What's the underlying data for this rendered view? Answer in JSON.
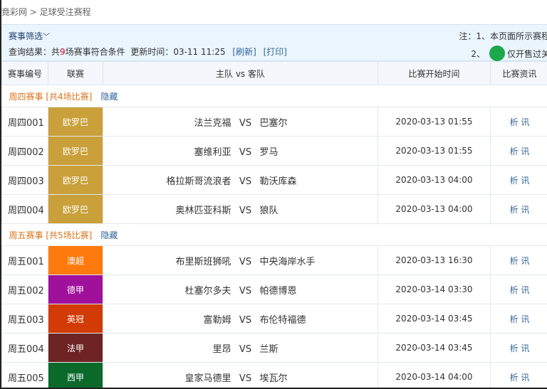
{
  "breadcrumb": "竟彩网 > 足球受注赛程",
  "filter": {
    "toggle_label": "赛事筛选",
    "result_prefix": "查询结果：共",
    "result_count": "9",
    "result_suffix": "场赛事符合条件",
    "update_label": "更新时间：03-11 11:25",
    "refresh_link": "[刷新]",
    "print_link": "[打印]",
    "note1": "注：1、本页面所示赛程",
    "note2_prefix": "2、",
    "note2_suffix": "仅开售过关"
  },
  "table": {
    "headers": [
      "赛事编号",
      "联赛",
      "主队 vs 客队",
      "比赛开始时间",
      "比赛资讯"
    ]
  },
  "groups": [
    {
      "title": "周四赛事 [共4场比赛]",
      "hide_label": "隐藏",
      "matches": [
        {
          "num": "周四001",
          "league": "欧罗巴",
          "color": "#c9a03a",
          "home": "法兰克福",
          "vs": "VS",
          "away": "巴塞尔",
          "time": "2020-03-13 01:55",
          "info": "析 讯"
        },
        {
          "num": "周四002",
          "league": "欧罗巴",
          "color": "#c9a03a",
          "home": "塞维利亚",
          "vs": "VS",
          "away": "罗马",
          "time": "2020-03-13 01:55",
          "info": "析 讯"
        },
        {
          "num": "周四003",
          "league": "欧罗巴",
          "color": "#c9a03a",
          "home": "格拉斯哥流浪者",
          "vs": "VS",
          "away": "勒沃库森",
          "time": "2020-03-13 04:00",
          "info": "析 讯"
        },
        {
          "num": "周四004",
          "league": "欧罗巴",
          "color": "#c9a03a",
          "home": "奥林匹亚科斯",
          "vs": "VS",
          "away": "狼队",
          "time": "2020-03-13 04:00",
          "info": "析 讯"
        }
      ]
    },
    {
      "title": "周五赛事 [共5场比赛]",
      "hide_label": "隐藏",
      "matches": [
        {
          "num": "周五001",
          "league": "澳超",
          "color": "#ff7a0d",
          "home": "布里斯班狮吼",
          "vs": "VS",
          "away": "中央海岸水手",
          "time": "2020-03-13 16:30",
          "info": "析 讯"
        },
        {
          "num": "周五002",
          "league": "德甲",
          "color": "#a0109b",
          "home": "杜塞尔多夫",
          "vs": "VS",
          "away": "帕德博恩",
          "time": "2020-03-14 03:30",
          "info": "析 讯"
        },
        {
          "num": "周五003",
          "league": "英冠",
          "color": "#d23a06",
          "home": "富勒姆",
          "vs": "VS",
          "away": "布伦特福德",
          "time": "2020-03-14 03:45",
          "info": "析 讯"
        },
        {
          "num": "周五004",
          "league": "法甲",
          "color": "#6e2424",
          "home": "里昂",
          "vs": "VS",
          "away": "兰斯",
          "time": "2020-03-14 03:45",
          "info": "析 讯"
        },
        {
          "num": "周五005",
          "league": "西甲",
          "color": "#0b6a2a",
          "home": "皇家马德里",
          "vs": "VS",
          "away": "埃瓦尔",
          "time": "2020-03-14 04:00",
          "info": "析 讯"
        }
      ]
    }
  ]
}
